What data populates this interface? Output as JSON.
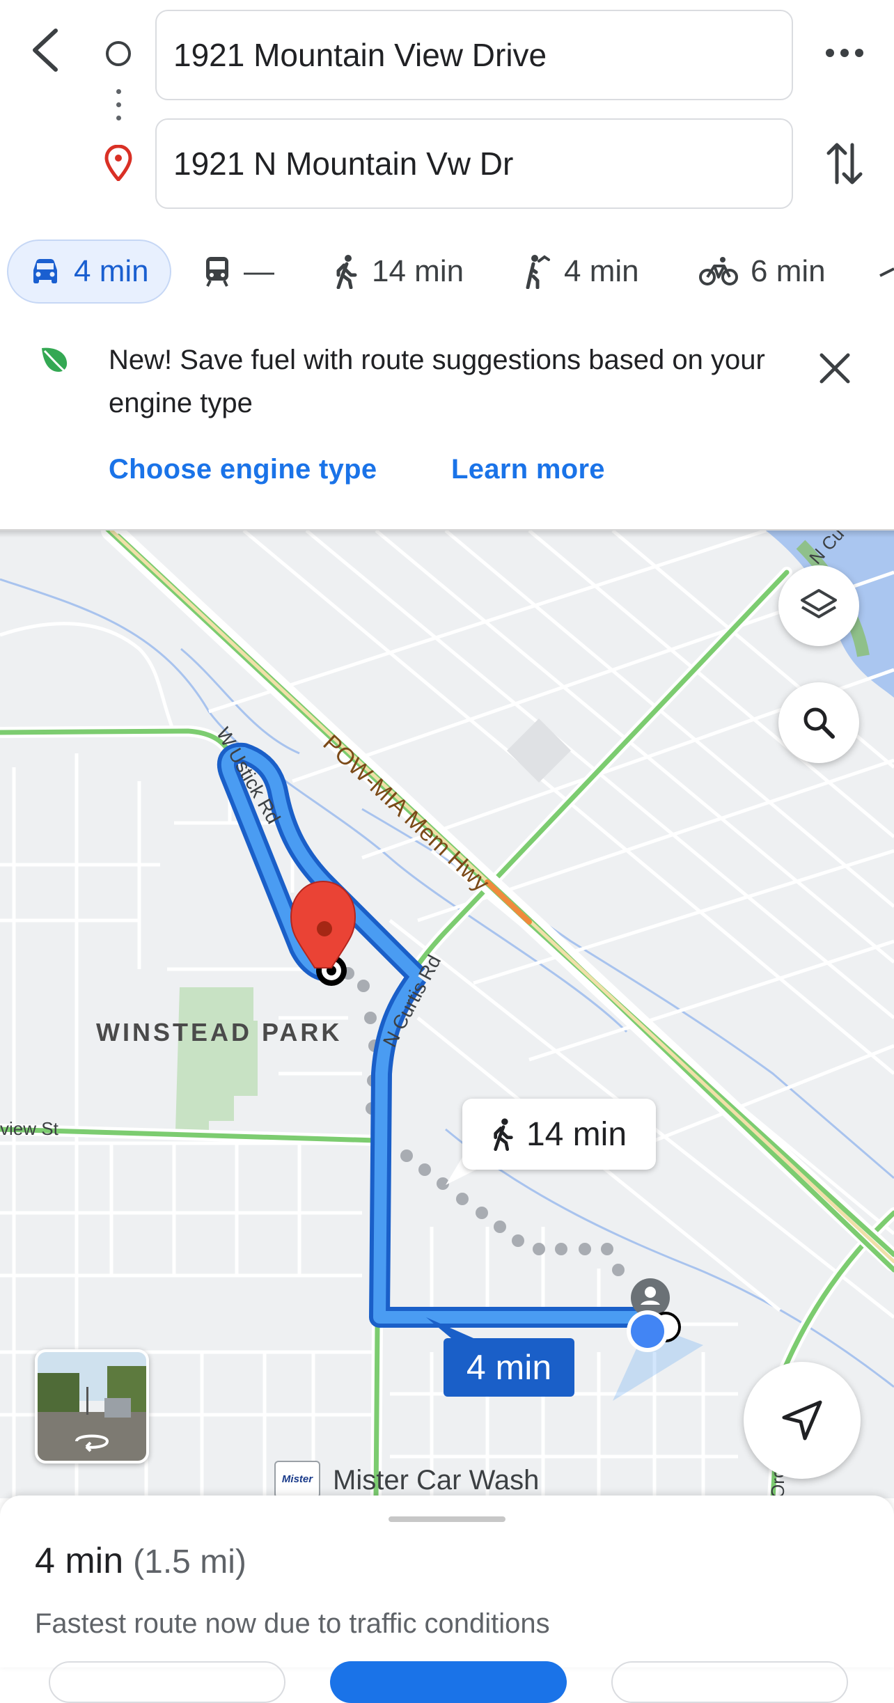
{
  "search": {
    "origin": "1921 Mountain View Drive",
    "destination": "1921 N Mountain Vw Dr"
  },
  "modes": [
    {
      "name": "driving",
      "label": "4 min",
      "selected": true
    },
    {
      "name": "transit",
      "label": "—"
    },
    {
      "name": "walking",
      "label": "14 min"
    },
    {
      "name": "ride-hailing",
      "label": "4 min"
    },
    {
      "name": "cycling",
      "label": "6 min"
    }
  ],
  "promo": {
    "text": "New! Save fuel with route suggestions based on your engine type",
    "link_engine": "Choose engine type",
    "link_learn": "Learn more"
  },
  "map": {
    "roads": {
      "ustick": "W Ustick Rd",
      "powmia": "POW-MIA Mem Hwy",
      "curtis": "N Curtis Rd",
      "view": "view St",
      "curtis_ne": "N Cu",
      "orch": "Orch"
    },
    "park": "WINSTEAD PARK",
    "carwash": "Mister Car Wash",
    "carwash_logo": "Mister",
    "walk_eta": "14 min",
    "drive_eta": "4 min"
  },
  "sheet": {
    "time": "4 min",
    "distance": "(1.5 mi)",
    "note": "Fastest route now due to traffic conditions"
  },
  "colors": {
    "accent": "#1a73e8",
    "route": "#4a9cf2",
    "traffic_green": "#7ccc70",
    "dest_pin": "#d93025"
  }
}
